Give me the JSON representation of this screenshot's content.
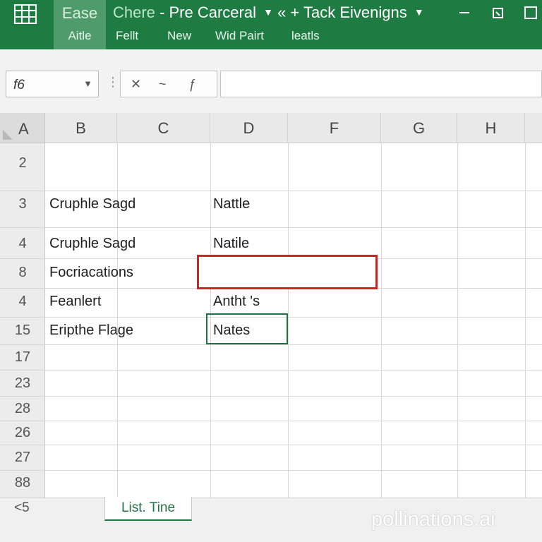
{
  "ribbon": {
    "app_icon": "spreadsheet-grid-icon",
    "home_tab": {
      "top": "Ease",
      "bottom": "Aitle"
    },
    "title": {
      "prefix": "Chere",
      "main": "- Pre Carceral",
      "suffix": "« + Tack Eivenigns"
    },
    "commands": [
      "Fellt",
      "New",
      "Wid Pairt",
      "leatls"
    ],
    "window_buttons": [
      "minimize-icon",
      "restore-icon",
      "close-icon"
    ],
    "accent": "#1e7b42"
  },
  "formula_bar": {
    "name_box": "f6",
    "cancel_glyph": "✕",
    "enter_glyph": "~",
    "function_glyph": "ƒ",
    "value": ""
  },
  "grid": {
    "corner_label": "A",
    "columns": [
      "B",
      "C",
      "D",
      "F",
      "G",
      "H"
    ],
    "rows": [
      "2",
      "3",
      "4",
      "8",
      "4",
      "15",
      "17",
      "23",
      "28",
      "26",
      "27",
      "88"
    ],
    "cells": {
      "b3": "Cruphle Sagd",
      "d3": "Nattle",
      "b4": "Cruphle Sagd",
      "d4": "Natile",
      "b8": "Focriacations",
      "b4b": "Feanlert",
      "d4b": "Antht 's",
      "b15": "Eripthe Flage",
      "d15": "Nates"
    }
  },
  "sheet_bar": {
    "nav_label": "<5",
    "active_tab": "List. Tine"
  },
  "watermark": "pollinations.ai"
}
